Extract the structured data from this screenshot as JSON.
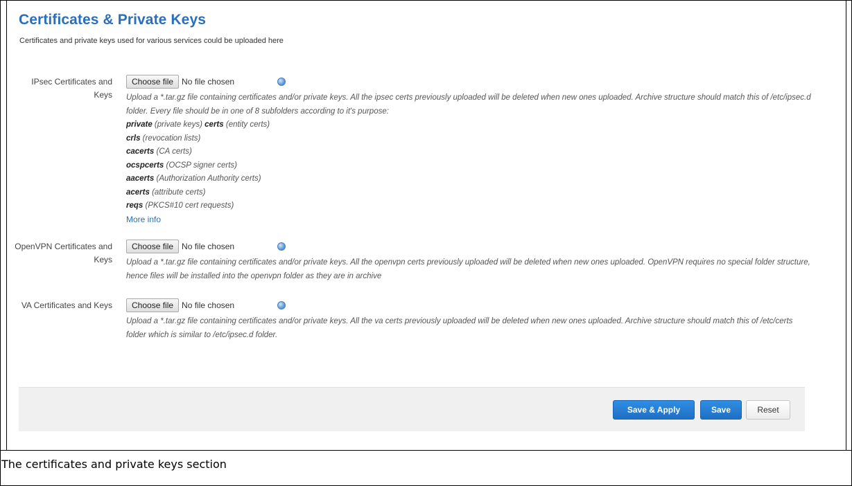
{
  "page": {
    "title": "Certificates & Private Keys",
    "description": "Certificates and private keys used for various services could be uploaded here"
  },
  "sections": {
    "ipsec": {
      "label": "IPsec Certificates and Keys",
      "button": "Choose file",
      "status": "No file chosen",
      "help_icon": "info-icon",
      "description": "Upload a *.tar.gz file containing certificates and/or private keys. All the ipsec certs previously uploaded will be deleted when new ones uploaded. Archive structure should match this of /etc/ipsec.d folder. Every file should be in one of 8 subfolders according to it's purpose:",
      "folders": [
        {
          "name": "private",
          "note": "(private keys)"
        },
        {
          "name": "certs",
          "note": "(entity certs)"
        },
        {
          "name": "crls",
          "note": "(revocation lists)"
        },
        {
          "name": "cacerts",
          "note": "(CA certs)"
        },
        {
          "name": "ocspcerts",
          "note": "(OCSP signer certs)"
        },
        {
          "name": "aacerts",
          "note": "(Authorization Authority certs)"
        },
        {
          "name": "acerts",
          "note": "(attribute certs)"
        },
        {
          "name": "reqs",
          "note": "(PKCS#10 cert requests)"
        }
      ],
      "more_info": "More info"
    },
    "openvpn": {
      "label": "OpenVPN Certificates and Keys",
      "button": "Choose file",
      "status": "No file chosen",
      "help_icon": "info-icon",
      "description": "Upload a *.tar.gz file containing certificates and/or private keys. All the openvpn certs previously uploaded will be deleted when new ones uploaded. OpenVPN requires no special folder structure, hence files will be installed into the openvpn folder as they are in archive"
    },
    "va": {
      "label": "VA Certificates and Keys",
      "button": "Choose file",
      "status": "No file chosen",
      "help_icon": "info-icon",
      "description": "Upload a *.tar.gz file containing certificates and/or private keys. All the va certs previously uploaded will be deleted when new ones uploaded. Archive structure should match this of /etc/certs folder which is similar to /etc/ipsec.d folder."
    }
  },
  "footer": {
    "save_apply": "Save & Apply",
    "save": "Save",
    "reset": "Reset"
  },
  "caption": "The certificates and private keys section",
  "colors": {
    "title": "#2a6fbb",
    "primary_button": "#1f6fc4",
    "footer_bar": "#f0f0f0"
  }
}
